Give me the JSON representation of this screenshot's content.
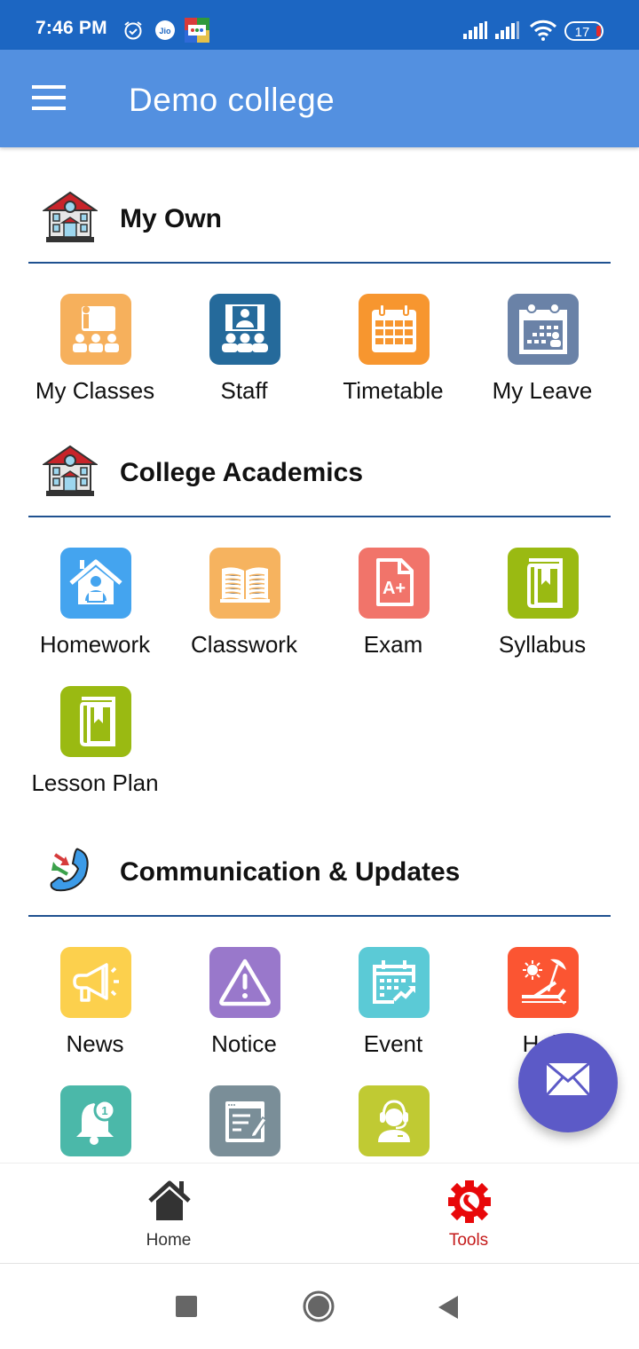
{
  "status_bar": {
    "time": "7:46 PM",
    "icons": [
      "alarm-icon",
      "jio-icon",
      "ludo-king-app-icon",
      "signal-icon",
      "signal-icon",
      "wifi-icon",
      "battery-icon"
    ],
    "battery_level": "17"
  },
  "app_bar": {
    "menu_icon": "hamburger-menu-icon",
    "title": "Demo college"
  },
  "sections": [
    {
      "title": "My Own",
      "icon": "school-building-icon",
      "items": [
        {
          "label": "My Classes",
          "icon": "teacher-class-icon",
          "color": "#f6b05c"
        },
        {
          "label": "Staff",
          "icon": "staff-group-icon",
          "color": "#256a9b"
        },
        {
          "label": "Timetable",
          "icon": "calendar-grid-icon",
          "color": "#f7962f"
        },
        {
          "label": "My Leave",
          "icon": "calendar-person-icon",
          "color": "#6a82a7"
        }
      ]
    },
    {
      "title": "College Academics",
      "icon": "school-building-icon",
      "items": [
        {
          "label": "Homework",
          "icon": "house-study-icon",
          "color": "#44a4ef"
        },
        {
          "label": "Classwork",
          "icon": "open-book-icon",
          "color": "#f6b35f"
        },
        {
          "label": "Exam",
          "icon": "grade-a-plus-icon",
          "color": "#f1746a"
        },
        {
          "label": "Syllabus",
          "icon": "bookmark-book-icon",
          "color": "#9aba12"
        },
        {
          "label": "Lesson Plan",
          "icon": "bookmark-book-icon",
          "color": "#9aba12"
        }
      ]
    },
    {
      "title": "Communication & Updates",
      "icon": "phone-call-icon",
      "items": [
        {
          "label": "News",
          "icon": "megaphone-icon",
          "color": "#fcd04d"
        },
        {
          "label": "Notice",
          "icon": "warning-triangle-icon",
          "color": "#9978cb"
        },
        {
          "label": "Event",
          "icon": "calendar-trend-icon",
          "color": "#5bcad6"
        },
        {
          "label": "Holi",
          "icon": "beach-holiday-icon",
          "color": "#fb5532"
        },
        {
          "label": "",
          "icon": "notification-bell-icon",
          "color": "#4bb8a9"
        },
        {
          "label": "",
          "icon": "note-edit-icon",
          "color": "#7a8e98"
        },
        {
          "label": "",
          "icon": "support-agent-icon",
          "color": "#c0ca33"
        }
      ]
    }
  ],
  "fab": {
    "icon": "mail-icon",
    "color": "#5c5ac7"
  },
  "bottom_nav": {
    "items": [
      {
        "label": "Home",
        "icon": "home-icon",
        "active": false,
        "color": "#333333"
      },
      {
        "label": "Tools",
        "icon": "tools-gear-icon",
        "active": true,
        "color": "#c41a1a"
      }
    ]
  },
  "system_nav": {
    "buttons": [
      "recents-square-icon",
      "home-circle-icon",
      "back-triangle-icon"
    ]
  },
  "theme": {
    "status_bar_color": "#1c66c2",
    "app_bar_color": "#5390e0",
    "divider_color": "#1f5190",
    "active_tab_color": "#c41a1a"
  }
}
